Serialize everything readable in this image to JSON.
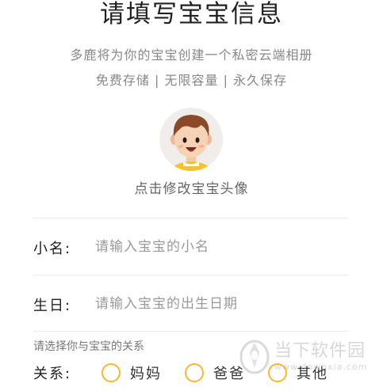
{
  "header": {
    "title": "请填写宝宝信息",
    "subtitle": "多鹿将为你的宝宝创建一个私密云端相册",
    "features": "免费存储 | 无限容量 | 永久保存"
  },
  "avatar": {
    "icon": "baby-face-avatar",
    "caption": "点击修改宝宝头像"
  },
  "form": {
    "nickname": {
      "label": "小名:",
      "value": "",
      "placeholder": "请输入宝宝的小名"
    },
    "birthday": {
      "label": "生日:",
      "value": "",
      "placeholder": "请输入宝宝的出生日期"
    },
    "relation": {
      "hint": "请选择你与宝宝的关系",
      "label": "关系:",
      "options": [
        "妈妈",
        "爸爸",
        "其他"
      ]
    }
  },
  "watermark": {
    "text": "当下软件园",
    "url": "www.downxia.com"
  },
  "colors": {
    "accent": "#f5b82e",
    "divider": "#ececec",
    "muted": "#888888"
  }
}
